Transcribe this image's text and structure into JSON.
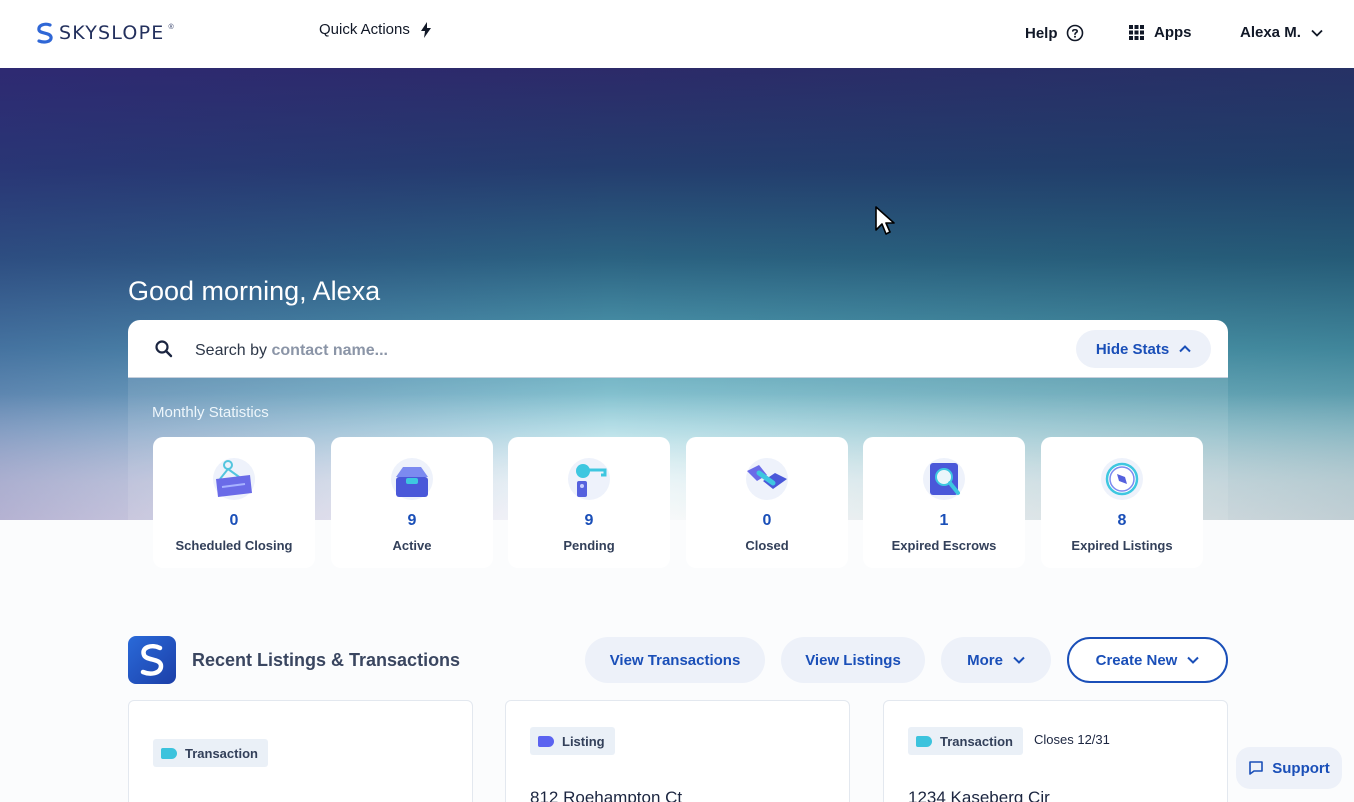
{
  "brand": {
    "name": "SKYSLOPE",
    "reg": "®",
    "color": "#23305d"
  },
  "header": {
    "quick_actions": "Quick Actions",
    "help": "Help",
    "apps": "Apps",
    "user": "Alexa M."
  },
  "hero": {
    "greeting": "Good morning, Alexa"
  },
  "search": {
    "prefix": "Search by",
    "placeholder": "contact name...",
    "hide_stats": "Hide Stats"
  },
  "stats": {
    "title": "Monthly Statistics",
    "items": [
      {
        "value": "0",
        "label": "Scheduled Closing",
        "icon": "closing-sign-icon"
      },
      {
        "value": "9",
        "label": "Active",
        "icon": "inbox-icon"
      },
      {
        "value": "9",
        "label": "Pending",
        "icon": "key-icon"
      },
      {
        "value": "0",
        "label": "Closed",
        "icon": "handshake-icon"
      },
      {
        "value": "1",
        "label": "Expired Escrows",
        "icon": "magnify-document-icon"
      },
      {
        "value": "8",
        "label": "Expired Listings",
        "icon": "compass-icon"
      }
    ]
  },
  "recent": {
    "title": "Recent Listings & Transactions",
    "view_transactions": "View Transactions",
    "view_listings": "View Listings",
    "more": "More",
    "create_new": "Create New",
    "cards": [
      {
        "tag": "Transaction",
        "tag_color": "#3cc3dd",
        "closes": "",
        "address": ""
      },
      {
        "tag": "Listing",
        "tag_color": "#5b63f0",
        "closes": "",
        "address": "812 Roehampton Ct"
      },
      {
        "tag": "Transaction",
        "tag_color": "#3cc3dd",
        "closes": "Closes 12/31",
        "address": "1234 Kaseberg Cir"
      }
    ]
  },
  "support": {
    "label": "Support"
  },
  "colors": {
    "accent": "#1a4fb8",
    "pill_bg": "#edf1f9"
  }
}
